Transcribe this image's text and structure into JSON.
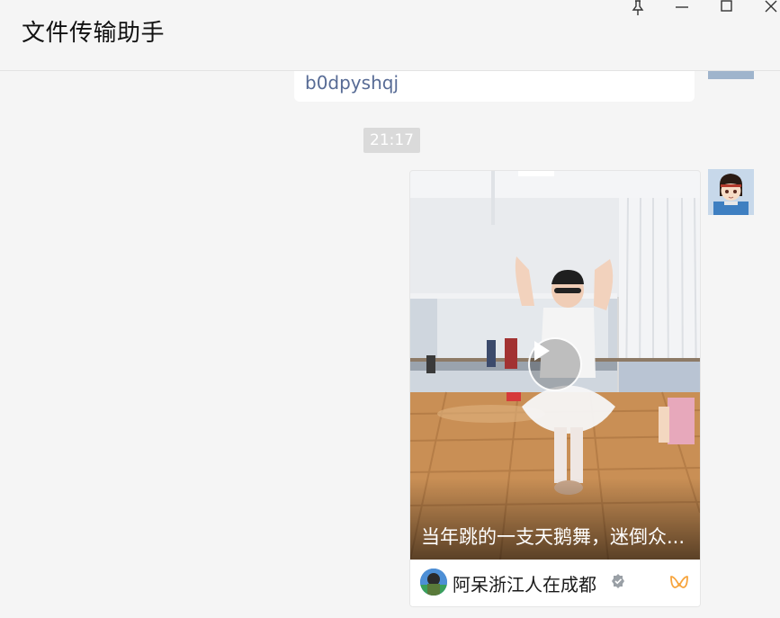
{
  "window": {
    "title": "文件传输助手",
    "controls": [
      "pin-icon",
      "minimize-icon",
      "maximize-icon",
      "close-icon"
    ]
  },
  "messages": {
    "previous": {
      "link_text": "b0dpyshqj"
    },
    "timestamp": "21:17",
    "video_card": {
      "caption": "当年跳的一支天鹅舞，迷倒众...",
      "author": "阿呆浙江人在成都",
      "verified_icon": "verified-badge-icon",
      "source_icon": "wechat-channels-icon",
      "play_icon": "play-icon"
    }
  },
  "colors": {
    "background": "#f5f5f5",
    "link": "#576b95",
    "timestamp_bg": "#dadada",
    "channels_accent": "#f7a43c"
  }
}
